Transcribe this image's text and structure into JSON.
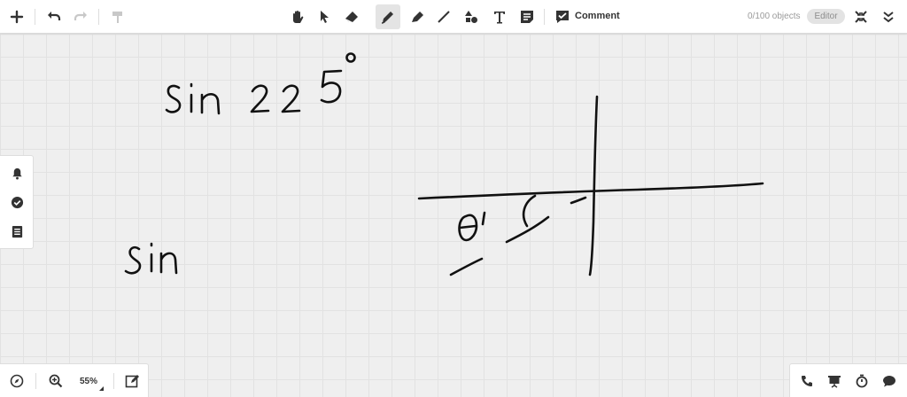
{
  "toolbar": {
    "add": "plus-icon",
    "undo": "undo-icon",
    "redo": "redo-icon",
    "format_painter": "paint-roller-icon",
    "pan": "hand-icon",
    "select": "cursor-icon",
    "eraser": "eraser-icon",
    "pen": "pen-icon",
    "highlighter": "highlighter-icon",
    "line": "line-icon",
    "shapes": "shapes-icon",
    "text": "text-icon",
    "sticky": "sticky-note-icon",
    "comment_label": "Comment",
    "objects_count": "0/100 objects",
    "editor_label": "Editor",
    "active_tool": "pen"
  },
  "side_panel": {
    "items": [
      "bell-icon",
      "check-circle-icon",
      "list-icon"
    ]
  },
  "bottom_left": {
    "zoom_level": "55%"
  },
  "bottom_right": {
    "items": [
      "phone-icon",
      "presentation-icon",
      "timer-icon",
      "chat-icon"
    ]
  },
  "colors": {
    "canvas_bg": "#efefef",
    "grid": "#e2e2e2",
    "ink": "#111111",
    "panel_bg": "#ffffff"
  },
  "canvas": {
    "handwritten": [
      "sin 225°",
      "sin",
      "θ'"
    ]
  }
}
